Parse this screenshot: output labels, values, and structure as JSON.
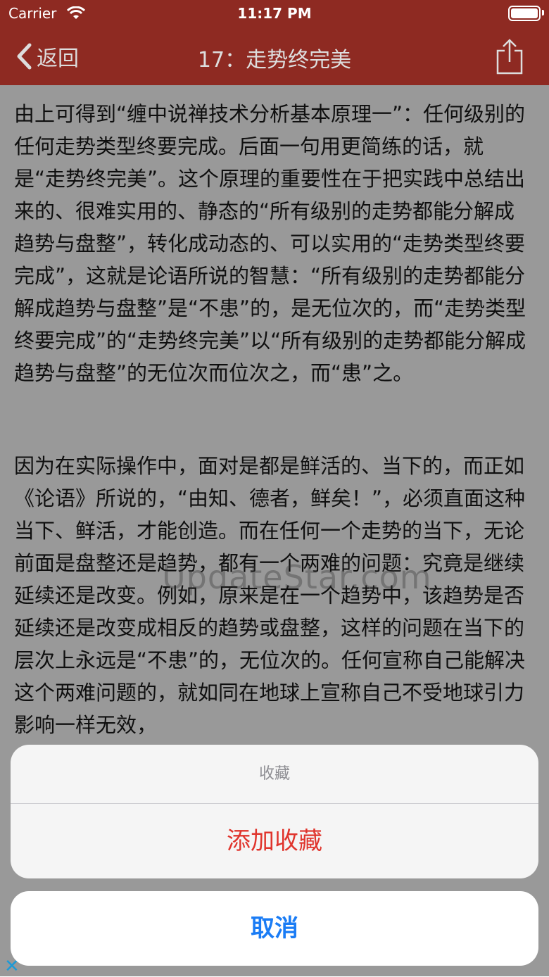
{
  "status_bar": {
    "carrier": "Carrier",
    "time": "11:17 PM"
  },
  "nav": {
    "back_label": "返回",
    "title": "17：走势终完美"
  },
  "content": {
    "paragraphs": [
      "由上可得到“缠中说禅技术分析基本原理一”：任何级别的任何走势类型终要完成。后面一句用更简练的话，就是“走势终完美”。这个原理的重要性在于把实践中总结出来的、很难实用的、静态的“所有级别的走势都能分解成趋势与盘整”，转化成动态的、可以实用的“走势类型终要完成”，这就是论语所说的智慧：“所有级别的走势都能分解成趋势与盘整”是“不患”的，是无位次的，而“走势类型终要完成”的“走势终完美”以“所有级别的走势都能分解成趋势与盘整”的无位次而位次之，而“患”之。",
      "因为在实际操作中，面对是都是鲜活的、当下的，而正如《论语》所说的，“由知、德者，鲜矣！”，必须直面这种当下、鲜活，才能创造。而在任何一个走势的当下，无论前面是盘整还是趋势，都有一个两难的问题：究竟是继续延续还是改变。例如，原来是在一个趋势中，该趋势是否延续还是改变成相反的趋势或盘整，这样的问题在当下的层次上永远是“不患”的，无位次的。任何宣称自己能解决这个两难问题的，就如同在地球上宣称自己不受地球引力影响一样无效，"
    ]
  },
  "watermark": "UpdateStar.com",
  "action_sheet": {
    "title": "收藏",
    "action_label": "添加收藏",
    "cancel_label": "取消"
  },
  "colors": {
    "nav_bar": "#8e2a22",
    "action_red": "#e0342c",
    "cancel_blue": "#1a7cf5"
  },
  "icons": {
    "back": "chevron-left-icon",
    "share": "share-icon",
    "wifi": "wifi-icon",
    "battery": "battery-icon",
    "ad_close": "close-icon"
  }
}
